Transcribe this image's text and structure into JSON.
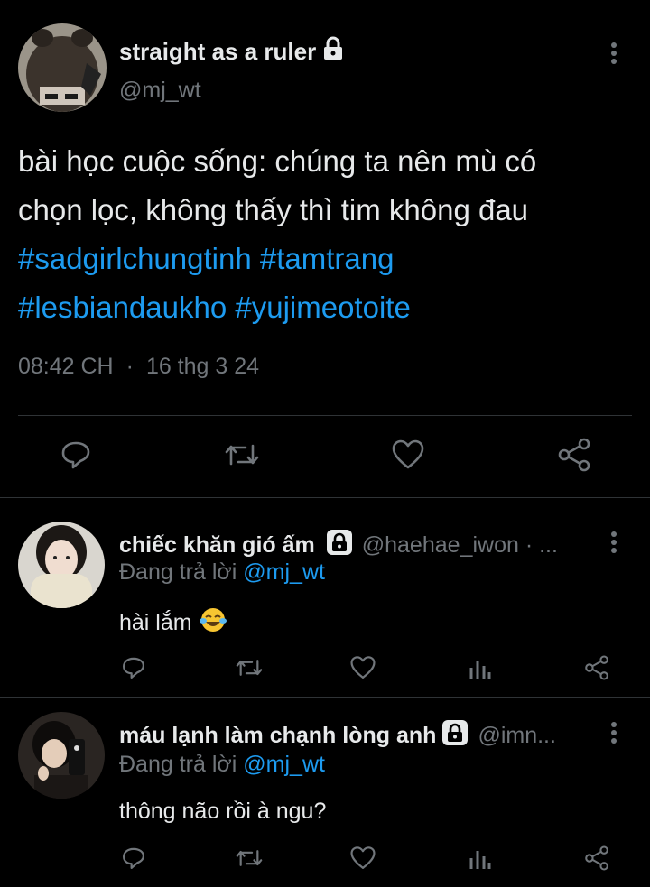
{
  "main_post": {
    "display_name": "straight as a ruler",
    "handle": "@mj_wt",
    "text_line1": "bài học cuộc sống: chúng ta nên mù có",
    "text_line2": "chọn lọc, không thấy thì tim không đau",
    "hashtags_line1": "#sadgirlchungtinh #tamtrang",
    "hashtags_line2": "#lesbiandaukho #yujimeotoite",
    "time": "08:42 CH",
    "separator": "·",
    "date": "16 thg 3 24"
  },
  "replies": [
    {
      "display_name": "chiếc khăn gió ấm",
      "handle": "@haehae_iwon · ...",
      "replying_prefix": "Đang trả lời ",
      "replying_to": "@mj_wt",
      "text": "hài lắm",
      "emoji": "face-with-tears-of-joy"
    },
    {
      "display_name": "máu lạnh làm chạnh lòng anh",
      "handle": "@imn...",
      "replying_prefix": "Đang trả lời ",
      "replying_to": "@mj_wt",
      "text": "thông não rồi à ngu?"
    }
  ],
  "colors": {
    "background": "#000000",
    "text": "#e7e9ea",
    "muted": "#71767b",
    "accent": "#1d9bf0",
    "divider": "#2f3336"
  },
  "icons": [
    "lock-icon",
    "more-icon",
    "reply-icon",
    "retweet-icon",
    "like-icon",
    "share-icon",
    "views-icon"
  ]
}
